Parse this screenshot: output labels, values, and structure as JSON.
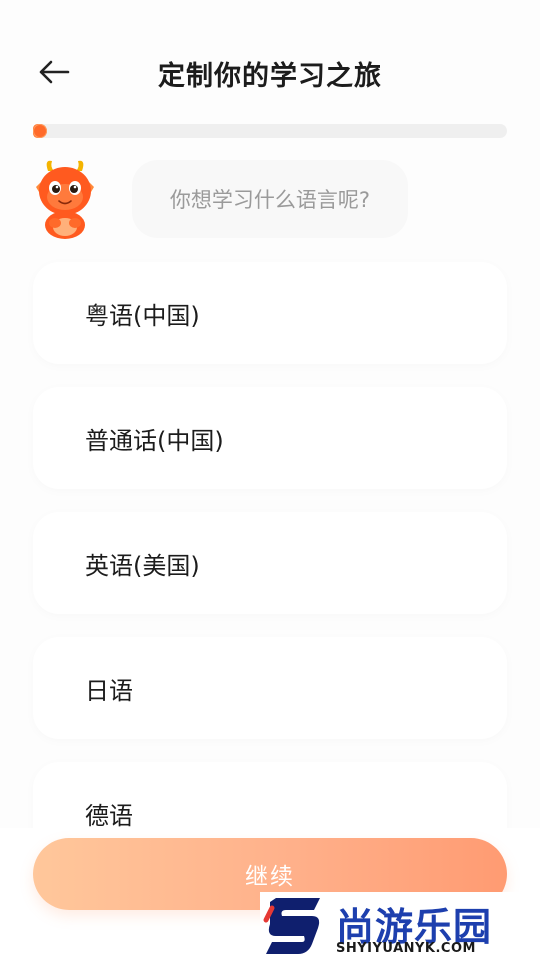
{
  "header": {
    "title": "定制你的学习之旅",
    "back_icon": "arrow-left-icon"
  },
  "progress": {
    "fraction": 0.02,
    "color": "#ff7a3a"
  },
  "prompt": {
    "question": "你想学习什么语言呢?",
    "mascot_icon": "dragon-mascot-icon"
  },
  "options": [
    {
      "label": "粤语(中国)"
    },
    {
      "label": "普通话(中国)"
    },
    {
      "label": "英语(美国)"
    },
    {
      "label": "日语"
    },
    {
      "label": "德语"
    }
  ],
  "footer": {
    "continue_label": "继续",
    "gradient_start": "#ffc79b",
    "gradient_end": "#ff9b72"
  },
  "watermark": {
    "name": "尚游乐园",
    "url": "SHYIYUANYK.COM",
    "brand_color": "#1d3fae"
  }
}
